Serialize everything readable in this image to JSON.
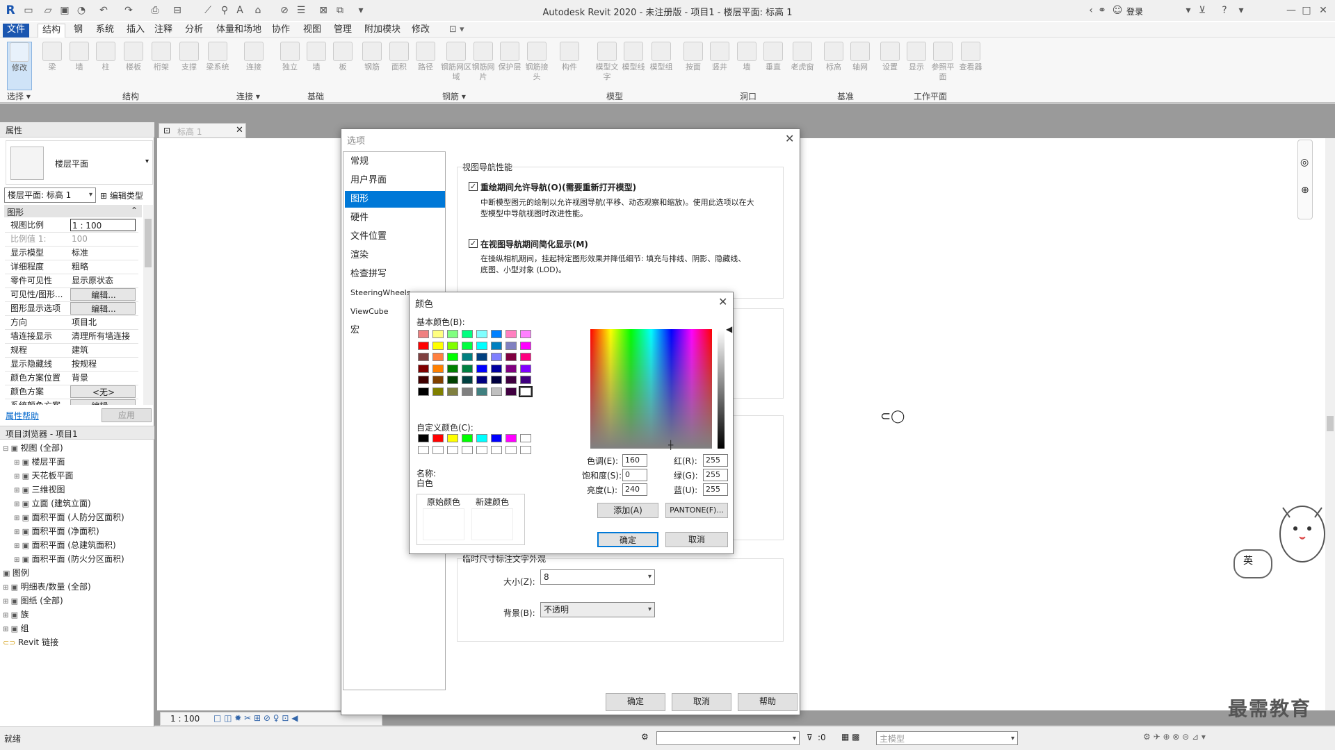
{
  "app": {
    "title": "Autodesk Revit 2020 - 未注册版 - 项目1 - 楼层平面: 标高 1",
    "login": "登录"
  },
  "menu": [
    "文件",
    "结构",
    "钢",
    "系统",
    "插入",
    "注释",
    "分析",
    "体量和场地",
    "协作",
    "视图",
    "管理",
    "附加模块",
    "修改"
  ],
  "ribbon": {
    "tools": [
      "修改",
      "梁",
      "墙",
      "柱",
      "楼板",
      "桁架",
      "支撑",
      "梁系统",
      "连接",
      "独立",
      "墙",
      "板",
      "钢筋",
      "面积",
      "路径",
      "钢筋网区域",
      "钢筋网片",
      "保护层",
      "钢筋接头",
      "构件",
      "模型文字",
      "模型线",
      "模型组",
      "按面",
      "竖井",
      "墙",
      "垂直",
      "老虎窗",
      "标高",
      "轴网",
      "设置",
      "显示",
      "参照平面",
      "查看器"
    ],
    "groups": [
      "选择 ▾",
      "结构",
      "连接 ▾",
      "基础",
      "钢筋 ▾",
      "模型",
      "洞口",
      "基准",
      "工作平面"
    ]
  },
  "props": {
    "header": "属性",
    "type": "楼层平面",
    "view_select": "楼层平面: 标高 1",
    "edit_type": "编辑类型",
    "section": "图形",
    "rows": [
      [
        "视图比例",
        "1 : 100"
      ],
      [
        "比例值 1:",
        "100"
      ],
      [
        "显示模型",
        "标准"
      ],
      [
        "详细程度",
        "粗略"
      ],
      [
        "零件可见性",
        "显示原状态"
      ],
      [
        "可见性/图形...",
        "编辑..."
      ],
      [
        "图形显示选项",
        "编辑..."
      ],
      [
        "方向",
        "项目北"
      ],
      [
        "墙连接显示",
        "清理所有墙连接"
      ],
      [
        "规程",
        "建筑"
      ],
      [
        "显示隐藏线",
        "按规程"
      ],
      [
        "颜色方案位置",
        "背景"
      ],
      [
        "颜色方案",
        "<无>"
      ],
      [
        "系统颜色方案",
        "编辑..."
      ]
    ],
    "help": "属性帮助",
    "apply": "应用"
  },
  "browser": {
    "header": "项目浏览器 - 项目1",
    "items": [
      "视图 (全部)",
      "楼层平面",
      "天花板平面",
      "三维视图",
      "立面 (建筑立面)",
      "面积平面 (人防分区面积)",
      "面积平面 (净面积)",
      "面积平面 (总建筑面积)",
      "面积平面 (防火分区面积)",
      "图例",
      "明细表/数量 (全部)",
      "图纸 (全部)",
      "族",
      "组",
      "Revit 链接"
    ]
  },
  "viewtab": "标高 1",
  "options": {
    "title": "选项",
    "nav": [
      "常规",
      "用户界面",
      "图形",
      "硬件",
      "文件位置",
      "渲染",
      "检查拼写",
      "SteeringWheels",
      "ViewCube",
      "宏"
    ],
    "section1": "视图导航性能",
    "cb1": "重绘期间允许导航(O)(需要重新打开模型)",
    "cb1_desc1": "中断模型图元的绘制以允许视图导航(平移、动态观察和缩放)。使用此选项以在大",
    "cb1_desc2": "型模型中导航视图时改进性能。",
    "cb2": "在视图导航期间简化显示(M)",
    "cb2_desc1": "在操纵相机期间，挂起特定图形效果并降低细节: 填充与排线、阴影、隐藏线、",
    "cb2_desc2": "底图、小型对象 (LOD)。",
    "section2": "临时尺寸标注文字外观",
    "size_label": "大小(Z):",
    "size_value": "8",
    "bg_label": "背景(B):",
    "bg_value": "不透明",
    "ok": "确定",
    "cancel": "取消",
    "help": "帮助"
  },
  "color": {
    "title": "颜色",
    "basic_label": "基本颜色(B):",
    "custom_label": "自定义颜色(C):",
    "name_label": "名称:",
    "name_value": "白色",
    "basic": [
      "#f08080",
      "#ffff80",
      "#80ff80",
      "#00ff80",
      "#80ffff",
      "#0080ff",
      "#ff80c0",
      "#ff80ff",
      "#ff0000",
      "#ffff00",
      "#80ff00",
      "#00ff40",
      "#00ffff",
      "#0080c0",
      "#8080c0",
      "#ff00ff",
      "#804040",
      "#ff8040",
      "#00ff00",
      "#008080",
      "#004080",
      "#8080ff",
      "#800040",
      "#ff0080",
      "#800000",
      "#ff8000",
      "#008000",
      "#008040",
      "#0000ff",
      "#0000a0",
      "#800080",
      "#8000ff",
      "#400000",
      "#804000",
      "#004000",
      "#004040",
      "#000080",
      "#000040",
      "#400040",
      "#400080",
      "#000000",
      "#808000",
      "#808040",
      "#808080",
      "#408080",
      "#c0c0c0",
      "#400040",
      "#ffffff"
    ],
    "custom": [
      "#000000",
      "#ff0000",
      "#ffff00",
      "#00ff00",
      "#00ffff",
      "#0000ff",
      "#ff00ff",
      "#ffffff",
      "#ffffff",
      "#ffffff",
      "#ffffff",
      "#ffffff",
      "#ffffff",
      "#ffffff",
      "#ffffff",
      "#ffffff"
    ],
    "orig_label": "原始颜色",
    "new_label": "新建颜色",
    "hue_label": "色调(E):",
    "hue": "160",
    "sat_label": "饱和度(S):",
    "sat": "0",
    "lum_label": "亮度(L):",
    "lum": "240",
    "r_label": "红(R):",
    "r": "255",
    "g_label": "绿(G):",
    "g": "255",
    "b_label": "蓝(U):",
    "b": "255",
    "add": "添加(A)",
    "pantone": "PANTONE(F)...",
    "ok": "确定",
    "cancel": "取消"
  },
  "status": {
    "left": "就绪",
    "scale": "1 : 100",
    "model": "主模型",
    "zero": ":0"
  },
  "watermark": "最需教育",
  "ime": "英"
}
